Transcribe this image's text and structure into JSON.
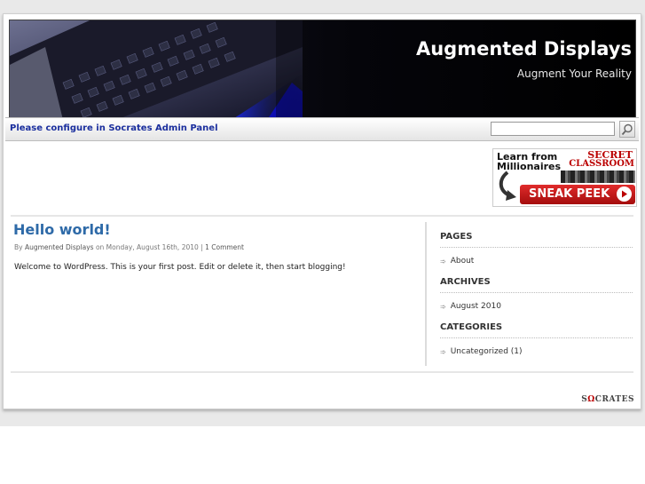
{
  "header": {
    "site_title": "Augmented Displays",
    "tagline": "Augment Your Reality"
  },
  "nav": {
    "message": "Please configure in Socrates Admin Panel",
    "search_placeholder": "",
    "search_icon": "magnifier-icon"
  },
  "ad": {
    "line1": "Learn from",
    "line2": "Millionaires",
    "secret": "SECRET",
    "classroom": "CLASSROOM",
    "cta": "SNEAK PEEK"
  },
  "post": {
    "title": "Hello world!",
    "meta_by": "By",
    "meta_author": "Augmented Displays",
    "meta_on": "on Monday, August 16th, 2010",
    "meta_sep": "|",
    "meta_comments": "1 Comment",
    "body": "Welcome to WordPress. This is your first post. Edit or delete it, then start blogging!"
  },
  "sidebar": {
    "pages_heading": "PAGES",
    "pages": [
      "About"
    ],
    "archives_heading": "ARCHIVES",
    "archives": [
      "August 2010"
    ],
    "categories_heading": "CATEGORIES",
    "categories": [
      "Uncategorized (1)"
    ]
  },
  "footer": {
    "logo_prefix": "S",
    "logo_omega": "Ω",
    "logo_suffix": "CRATES"
  },
  "colors": {
    "title_blue": "#2e6aa8",
    "nav_text": "#1b2f9e",
    "ad_red": "#b00"
  }
}
